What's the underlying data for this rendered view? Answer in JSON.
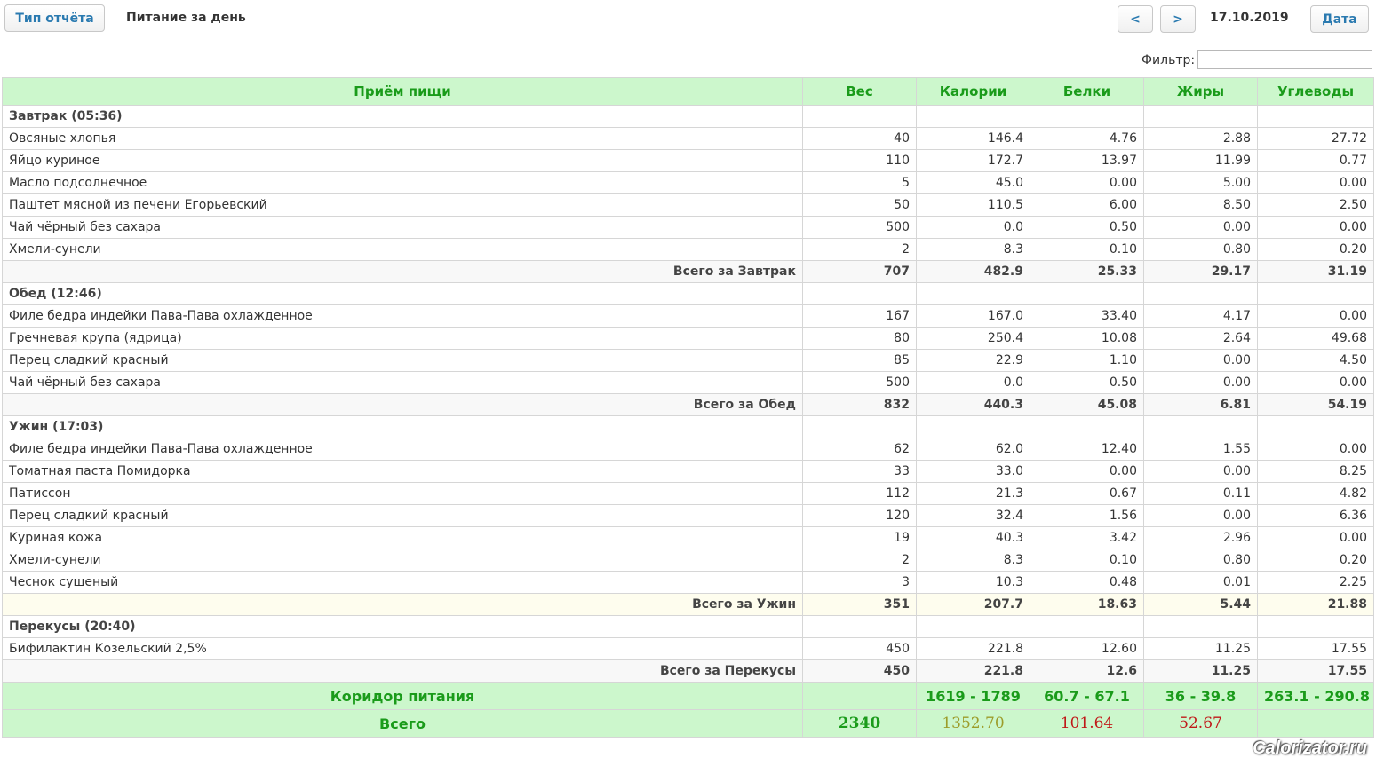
{
  "header": {
    "report_type_button": "Тип отчёта",
    "title": "Питание за день",
    "prev_button": "<",
    "next_button": ">",
    "date": "17.10.2019",
    "date_button": "Дата"
  },
  "filter": {
    "label": "Фильтр:",
    "value": ""
  },
  "table": {
    "columns": [
      "Приём пищи",
      "Вес",
      "Калории",
      "Белки",
      "Жиры",
      "Углеводы"
    ],
    "meals": [
      {
        "title": "Завтрак (05:36)",
        "items": [
          [
            "Овсяные хлопья",
            "40",
            "146.4",
            "4.76",
            "2.88",
            "27.72"
          ],
          [
            "Яйцо куриное",
            "110",
            "172.7",
            "13.97",
            "11.99",
            "0.77"
          ],
          [
            "Масло подсолнечное",
            "5",
            "45.0",
            "0.00",
            "5.00",
            "0.00"
          ],
          [
            "Паштет мясной из печени Егорьевский",
            "50",
            "110.5",
            "6.00",
            "8.50",
            "2.50"
          ],
          [
            "Чай чёрный без сахара",
            "500",
            "0.0",
            "0.50",
            "0.00",
            "0.00"
          ],
          [
            "Хмели-сунели",
            "2",
            "8.3",
            "0.10",
            "0.80",
            "0.20"
          ]
        ],
        "total": [
          "Всего за Завтрак",
          "707",
          "482.9",
          "25.33",
          "29.17",
          "31.19"
        ]
      },
      {
        "title": "Обед (12:46)",
        "items": [
          [
            "Филе бедра индейки Пава-Пава охлажденное",
            "167",
            "167.0",
            "33.40",
            "4.17",
            "0.00"
          ],
          [
            "Гречневая крупа (ядрица)",
            "80",
            "250.4",
            "10.08",
            "2.64",
            "49.68"
          ],
          [
            "Перец сладкий красный",
            "85",
            "22.9",
            "1.10",
            "0.00",
            "4.50"
          ],
          [
            "Чай чёрный без сахара",
            "500",
            "0.0",
            "0.50",
            "0.00",
            "0.00"
          ]
        ],
        "total": [
          "Всего за Обед",
          "832",
          "440.3",
          "45.08",
          "6.81",
          "54.19"
        ]
      },
      {
        "title": "Ужин (17:03)",
        "items": [
          [
            "Филе бедра индейки Пава-Пава охлажденное",
            "62",
            "62.0",
            "12.40",
            "1.55",
            "0.00"
          ],
          [
            "Томатная паста Помидорка",
            "33",
            "33.0",
            "0.00",
            "0.00",
            "8.25"
          ],
          [
            "Патиссон",
            "112",
            "21.3",
            "0.67",
            "0.11",
            "4.82"
          ],
          [
            "Перец сладкий красный",
            "120",
            "32.4",
            "1.56",
            "0.00",
            "6.36"
          ],
          [
            "Куриная кожа",
            "19",
            "40.3",
            "3.42",
            "2.96",
            "0.00"
          ],
          [
            "Хмели-сунели",
            "2",
            "8.3",
            "0.10",
            "0.80",
            "0.20"
          ],
          [
            "Чеснок сушеный",
            "3",
            "10.3",
            "0.48",
            "0.01",
            "2.25"
          ]
        ],
        "total": [
          "Всего за Ужин",
          "351",
          "207.7",
          "18.63",
          "5.44",
          "21.88"
        ]
      },
      {
        "title": "Перекусы (20:40)",
        "items": [
          [
            "Бифилактин Козельский 2,5%",
            "450",
            "221.8",
            "12.60",
            "11.25",
            "17.55"
          ]
        ],
        "total": [
          "Всего за Перекусы",
          "450",
          "221.8",
          "12.6",
          "11.25",
          "17.55"
        ]
      }
    ],
    "corridor": [
      "Коридор питания",
      "",
      "1619 - 1789",
      "60.7 - 67.1",
      "36 - 39.8",
      "263.1 - 290.8"
    ],
    "grand_total": [
      "Всего",
      "2340",
      "1352.70",
      "101.64",
      "52.67",
      ""
    ]
  },
  "watermark": "Calorizator.ru",
  "colors": {
    "header_bg": "#ccf7cc",
    "header_text": "#1a9b1a",
    "button_text": "#2a7ab0",
    "total_olive": "#9c9c2a",
    "total_red": "#c01818"
  }
}
